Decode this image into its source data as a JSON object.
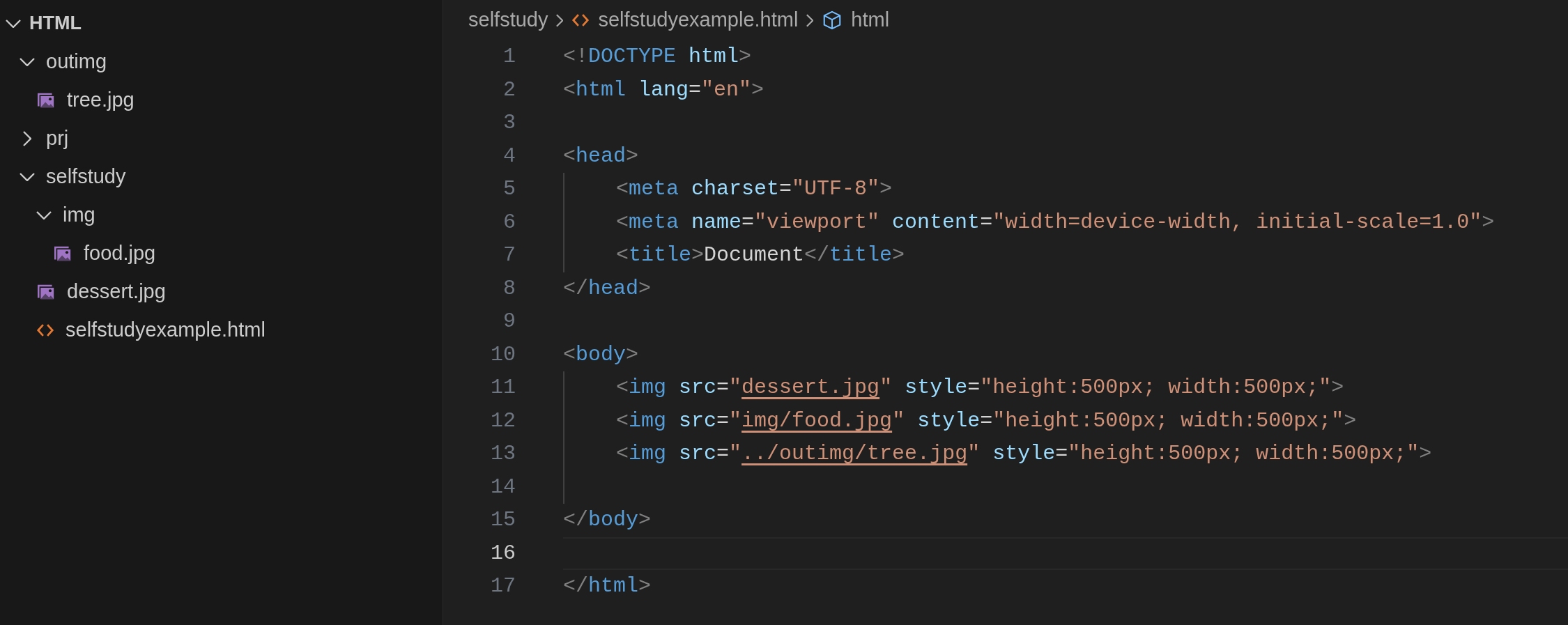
{
  "explorer": {
    "root": {
      "label": "HTML",
      "expanded": true
    },
    "items": [
      {
        "label": "outimg",
        "kind": "folder",
        "expanded": true,
        "children": [
          {
            "label": "tree.jpg",
            "kind": "image"
          }
        ]
      },
      {
        "label": "prj",
        "kind": "folder",
        "expanded": false
      },
      {
        "label": "selfstudy",
        "kind": "folder",
        "expanded": true,
        "children": [
          {
            "label": "img",
            "kind": "folder",
            "expanded": true,
            "children": [
              {
                "label": "food.jpg",
                "kind": "image"
              }
            ]
          },
          {
            "label": "dessert.jpg",
            "kind": "image"
          },
          {
            "label": "selfstudyexample.html",
            "kind": "html"
          }
        ]
      }
    ]
  },
  "breadcrumb": [
    {
      "label": "selfstudy",
      "kind": "folder"
    },
    {
      "label": "selfstudyexample.html",
      "kind": "html"
    },
    {
      "label": "html",
      "kind": "element"
    }
  ],
  "editor": {
    "lines": [
      {
        "number": "1",
        "indented": false,
        "selected": false,
        "tokens": [
          {
            "text": "<!",
            "kind": "punct"
          },
          {
            "text": "DOCTYPE",
            "kind": "tag"
          },
          {
            "text": "html",
            "kind": "attr",
            "spaced": true
          },
          {
            "text": ">",
            "kind": "punct"
          }
        ]
      },
      {
        "number": "2",
        "indented": false,
        "selected": false,
        "tokens": [
          {
            "text": "<",
            "kind": "punct"
          },
          {
            "text": "html",
            "kind": "tag"
          },
          {
            "text": "lang",
            "kind": "attr",
            "spaced": true
          },
          {
            "text": "=",
            "kind": "text"
          },
          {
            "text": "\"en\"",
            "kind": "string"
          },
          {
            "text": ">",
            "kind": "punct"
          }
        ]
      },
      {
        "number": "3",
        "indented": false,
        "selected": false
      },
      {
        "number": "4",
        "indented": false,
        "selected": false,
        "tokens": [
          {
            "text": "<",
            "kind": "punct"
          },
          {
            "text": "head",
            "kind": "tag"
          },
          {
            "text": ">",
            "kind": "punct"
          }
        ]
      },
      {
        "number": "5",
        "indented": true,
        "selected": false,
        "tokens": [
          {
            "text": "<",
            "kind": "punct"
          },
          {
            "text": "meta",
            "kind": "tag"
          },
          {
            "text": "charset",
            "kind": "attr",
            "spaced": true
          },
          {
            "text": "=",
            "kind": "text"
          },
          {
            "text": "\"UTF-8\"",
            "kind": "string"
          },
          {
            "text": ">",
            "kind": "punct"
          }
        ]
      },
      {
        "number": "6",
        "indented": true,
        "selected": false,
        "tokens": [
          {
            "text": "<",
            "kind": "punct"
          },
          {
            "text": "meta",
            "kind": "tag"
          },
          {
            "text": "name",
            "kind": "attr",
            "spaced": true
          },
          {
            "text": "=",
            "kind": "text"
          },
          {
            "text": "\"viewport\"",
            "kind": "string"
          },
          {
            "text": "content",
            "kind": "attr",
            "spaced": true
          },
          {
            "text": "=",
            "kind": "text"
          },
          {
            "text": "\"width=device-width, initial-scale=1.0\"",
            "kind": "string"
          },
          {
            "text": ">",
            "kind": "punct"
          }
        ]
      },
      {
        "number": "7",
        "indented": true,
        "selected": false,
        "tokens": [
          {
            "text": "<",
            "kind": "punct"
          },
          {
            "text": "title",
            "kind": "tag"
          },
          {
            "text": ">",
            "kind": "punct"
          },
          {
            "text": "Document",
            "kind": "text"
          },
          {
            "text": "</",
            "kind": "punct"
          },
          {
            "text": "title",
            "kind": "tag"
          },
          {
            "text": ">",
            "kind": "punct"
          }
        ]
      },
      {
        "number": "8",
        "indented": false,
        "selected": false,
        "tokens": [
          {
            "text": "</",
            "kind": "punct"
          },
          {
            "text": "head",
            "kind": "tag"
          },
          {
            "text": ">",
            "kind": "punct"
          }
        ]
      },
      {
        "number": "9",
        "indented": false,
        "selected": false
      },
      {
        "number": "10",
        "indented": false,
        "selected": false,
        "tokens": [
          {
            "text": "<",
            "kind": "punct"
          },
          {
            "text": "body",
            "kind": "tag"
          },
          {
            "text": ">",
            "kind": "punct"
          }
        ]
      },
      {
        "number": "11",
        "indented": true,
        "selected": false,
        "tokens": [
          {
            "text": "<",
            "kind": "punct"
          },
          {
            "text": "img",
            "kind": "tag"
          },
          {
            "text": "src",
            "kind": "attr",
            "spaced": true
          },
          {
            "text": "=",
            "kind": "text"
          },
          {
            "text": "\"",
            "kind": "string"
          },
          {
            "text": "dessert.jpg",
            "kind": "link"
          },
          {
            "text": "\"",
            "kind": "string"
          },
          {
            "text": "style",
            "kind": "attr",
            "spaced": true
          },
          {
            "text": "=",
            "kind": "text"
          },
          {
            "text": "\"height:500px; width:500px;\"",
            "kind": "string"
          },
          {
            "text": ">",
            "kind": "punct"
          }
        ]
      },
      {
        "number": "12",
        "indented": true,
        "selected": false,
        "tokens": [
          {
            "text": "<",
            "kind": "punct"
          },
          {
            "text": "img",
            "kind": "tag"
          },
          {
            "text": "src",
            "kind": "attr",
            "spaced": true
          },
          {
            "text": "=",
            "kind": "text"
          },
          {
            "text": "\"",
            "kind": "string"
          },
          {
            "text": "img/food.jpg",
            "kind": "link"
          },
          {
            "text": "\"",
            "kind": "string"
          },
          {
            "text": "style",
            "kind": "attr",
            "spaced": true
          },
          {
            "text": "=",
            "kind": "text"
          },
          {
            "text": "\"height:500px; width:500px;\"",
            "kind": "string"
          },
          {
            "text": ">",
            "kind": "punct"
          }
        ]
      },
      {
        "number": "13",
        "indented": true,
        "selected": false,
        "tokens": [
          {
            "text": "<",
            "kind": "punct"
          },
          {
            "text": "img",
            "kind": "tag"
          },
          {
            "text": "src",
            "kind": "attr",
            "spaced": true
          },
          {
            "text": "=",
            "kind": "text"
          },
          {
            "text": "\"",
            "kind": "string"
          },
          {
            "text": "../outimg/tree.jpg",
            "kind": "link"
          },
          {
            "text": "\"",
            "kind": "string"
          },
          {
            "text": "style",
            "kind": "attr",
            "spaced": true
          },
          {
            "text": "=",
            "kind": "text"
          },
          {
            "text": "\"height:500px; width:500px;\"",
            "kind": "string"
          },
          {
            "text": ">",
            "kind": "punct"
          }
        ]
      },
      {
        "number": "14",
        "indented": true,
        "selected": false
      },
      {
        "number": "15",
        "indented": false,
        "selected": false,
        "tokens": [
          {
            "text": "</",
            "kind": "punct"
          },
          {
            "text": "body",
            "kind": "tag"
          },
          {
            "text": ">",
            "kind": "punct"
          }
        ]
      },
      {
        "number": "16",
        "indented": false,
        "selected": true
      },
      {
        "number": "17",
        "indented": false,
        "selected": false,
        "tokens": [
          {
            "text": "</",
            "kind": "punct"
          },
          {
            "text": "html",
            "kind": "tag"
          },
          {
            "text": ">",
            "kind": "punct"
          }
        ]
      }
    ]
  }
}
